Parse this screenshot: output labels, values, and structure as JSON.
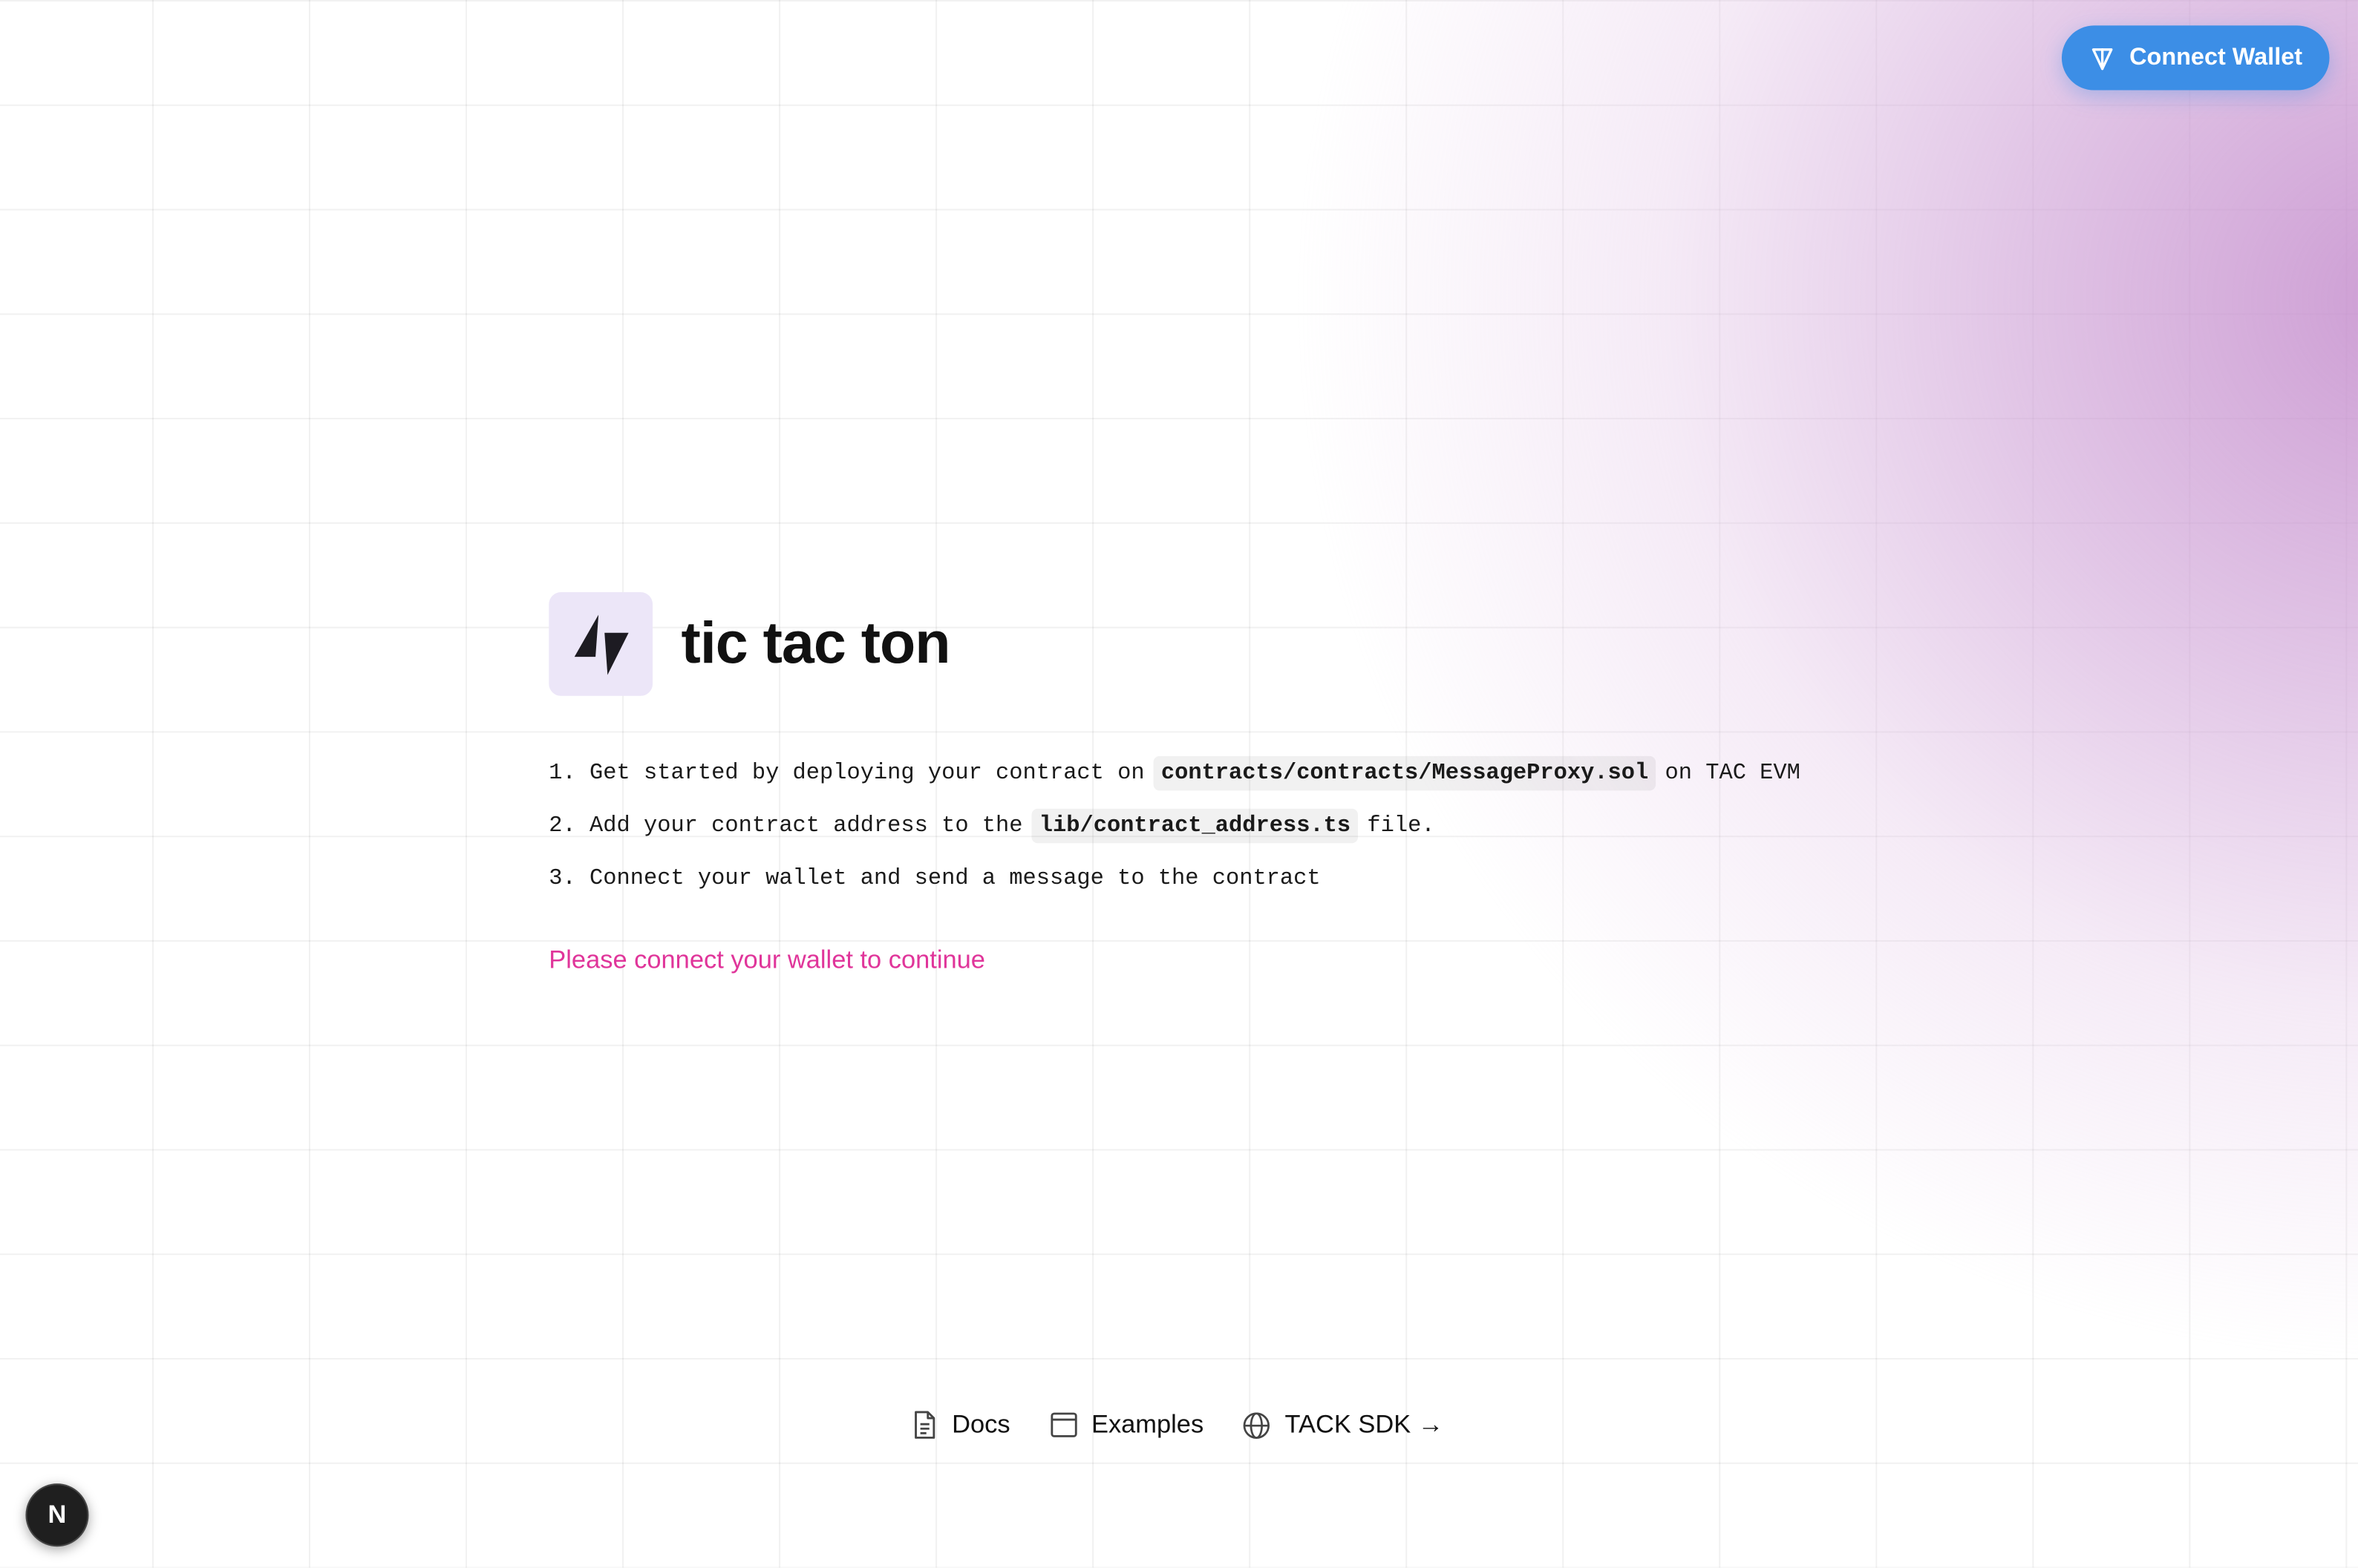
{
  "header": {
    "connect_wallet_label": "Connect Wallet",
    "connect_wallet_icon": "ton-diamond-icon",
    "accent_color": "#3c8ee6"
  },
  "hero": {
    "logo_icon": "lightning-bolt-icon",
    "title": "tic tac ton"
  },
  "steps": [
    {
      "number": "1.",
      "before": "Get started by deploying your contract on",
      "code": "contracts/contracts/MessageProxy.sol",
      "after": "on TAC EVM"
    },
    {
      "number": "2.",
      "before": "Add your contract address to the",
      "code": "lib/contract_address.ts",
      "after": "file."
    },
    {
      "number": "3.",
      "before": "Connect your wallet and send a message to the contract",
      "code": "",
      "after": ""
    }
  ],
  "status": {
    "message": "Please connect your wallet to continue",
    "color": "#e0359a"
  },
  "footer": {
    "links": [
      {
        "label": "Docs",
        "icon": "document-icon"
      },
      {
        "label": "Examples",
        "icon": "window-icon"
      },
      {
        "label": "TACK SDK →",
        "icon": "globe-icon"
      }
    ]
  },
  "dev_badge": {
    "label": "N",
    "icon": "nextjs-icon"
  }
}
